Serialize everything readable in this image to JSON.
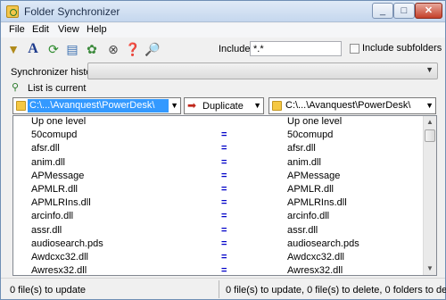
{
  "window": {
    "title": "Folder Synchronizer"
  },
  "menu": [
    "File",
    "Edit",
    "View",
    "Help"
  ],
  "toolbar": {
    "include_label": "Include:",
    "include_value": "*.*",
    "include_subfolders_label": "Include subfolders",
    "include_subfolders_checked": false
  },
  "history": {
    "label": "Synchronizer history:"
  },
  "list_status": "List is current",
  "left_path": "C:\\...\\Avanquest\\PowerDesk\\",
  "action": "Duplicate",
  "right_path": "C:\\...\\Avanquest\\PowerDesk\\",
  "rows": [
    {
      "left": "Up one level",
      "mid": "",
      "right": "Up one level"
    },
    {
      "left": "50comupd",
      "mid": "=",
      "right": "50comupd"
    },
    {
      "left": "afsr.dll",
      "mid": "=",
      "right": "afsr.dll"
    },
    {
      "left": "anim.dll",
      "mid": "=",
      "right": "anim.dll"
    },
    {
      "left": "APMessage",
      "mid": "=",
      "right": "APMessage"
    },
    {
      "left": "APMLR.dll",
      "mid": "=",
      "right": "APMLR.dll"
    },
    {
      "left": "APMLRIns.dll",
      "mid": "=",
      "right": "APMLRIns.dll"
    },
    {
      "left": "arcinfo.dll",
      "mid": "=",
      "right": "arcinfo.dll"
    },
    {
      "left": "assr.dll",
      "mid": "=",
      "right": "assr.dll"
    },
    {
      "left": "audiosearch.pds",
      "mid": "=",
      "right": "audiosearch.pds"
    },
    {
      "left": "Awdcxc32.dll",
      "mid": "=",
      "right": "Awdcxc32.dll"
    },
    {
      "left": "Awresx32.dll",
      "mid": "=",
      "right": "Awresx32.dll"
    }
  ],
  "status": {
    "left": "0 file(s) to update",
    "right": "0 file(s) to update, 0 file(s) to delete, 0 folders to dele"
  }
}
